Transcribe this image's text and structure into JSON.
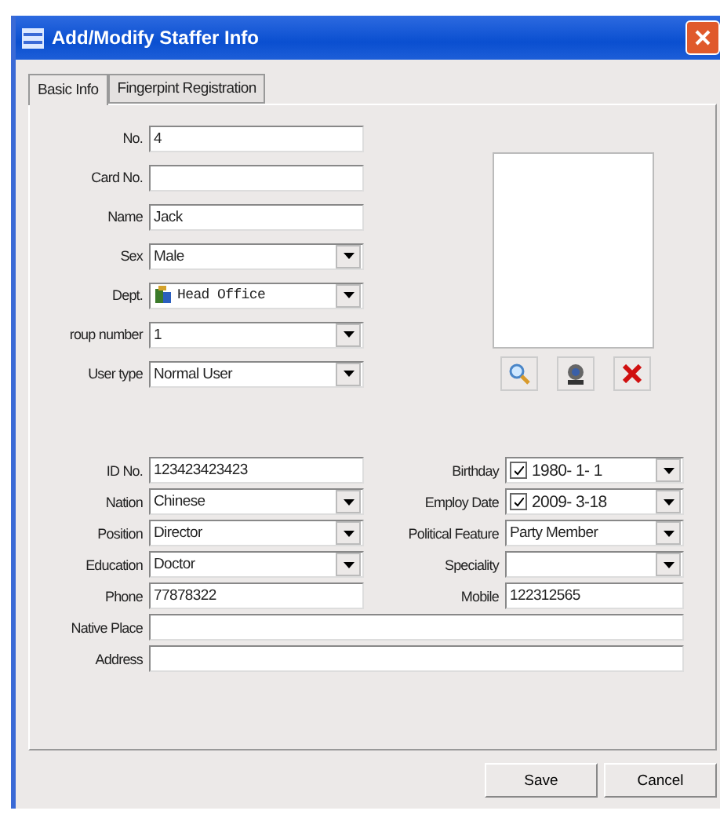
{
  "window": {
    "title": "Add/Modify Staffer Info"
  },
  "tabs": [
    {
      "label": "Basic Info",
      "selected": true
    },
    {
      "label": "Fingerpint Registration",
      "selected": false
    }
  ],
  "top_fields": [
    {
      "label": "No.",
      "kind": "text",
      "value": "4"
    },
    {
      "label": "Card No.",
      "kind": "text"
    },
    {
      "label": "Name",
      "kind": "text",
      "value": "Jack"
    },
    {
      "label": "Sex",
      "kind": "combo",
      "value": "Male"
    },
    {
      "label": "Dept.",
      "kind": "combo-icon",
      "value": "Head Office"
    },
    {
      "label": "roup number",
      "kind": "combo",
      "value": "1"
    },
    {
      "label": "User type",
      "kind": "combo",
      "value": "Normal User"
    }
  ],
  "photo_buttons": [
    {
      "kind": "browse"
    },
    {
      "kind": "camera"
    },
    {
      "kind": "delete"
    }
  ],
  "detail_rows": [
    {
      "left": {
        "label": "ID No.",
        "kind": "text",
        "value": "123423423423"
      },
      "right": {
        "label": "Birthday",
        "kind": "date",
        "checked": true,
        "value": "1980- 1- 1"
      }
    },
    {
      "left": {
        "label": "Nation",
        "kind": "combo",
        "value": "Chinese"
      },
      "right": {
        "label": "Employ Date",
        "kind": "date",
        "checked": true,
        "value": "2009- 3-18"
      }
    },
    {
      "left": {
        "label": "Position",
        "kind": "combo",
        "value": "Director"
      },
      "right": {
        "label": "Political Feature",
        "kind": "combo",
        "value": "Party Member"
      }
    },
    {
      "left": {
        "label": "Education",
        "kind": "combo",
        "value": "Doctor"
      },
      "right": {
        "label": "Speciality",
        "kind": "combo"
      }
    },
    {
      "left": {
        "label": "Phone",
        "kind": "text",
        "value": "77878322"
      },
      "right": {
        "label": "Mobile",
        "kind": "text",
        "value": "122312565"
      }
    }
  ],
  "wide_fields": [
    {
      "label": "Native Place"
    },
    {
      "label": "Address"
    }
  ],
  "buttons": [
    "Save",
    "Cancel"
  ]
}
